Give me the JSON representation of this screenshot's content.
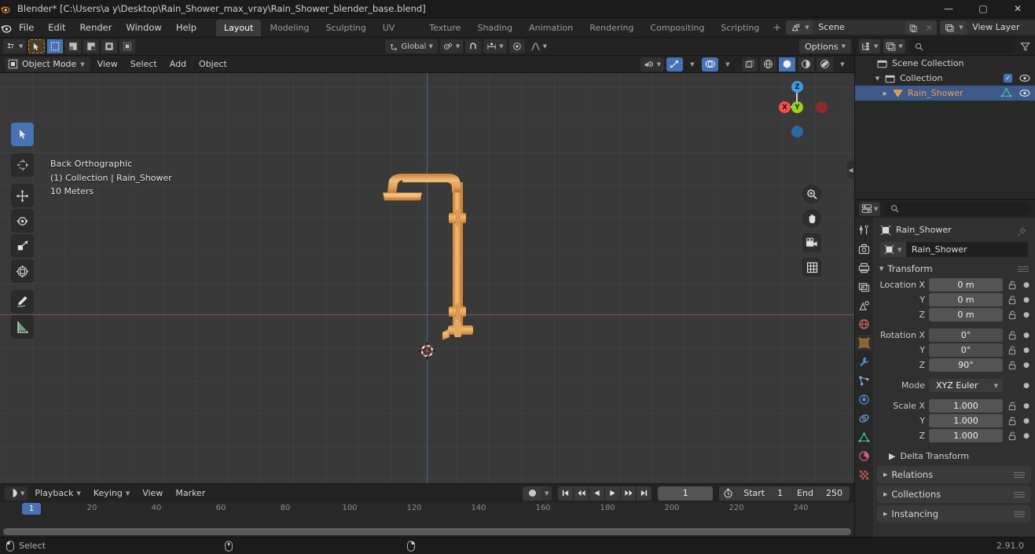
{
  "window": {
    "title": "Blender* [C:\\Users\\a y\\Desktop\\Rain_Shower_max_vray\\Rain_Shower_blender_base.blend]",
    "app_icon": "blender-logo-icon",
    "minimize": "—",
    "maximize": "▢",
    "close": "✕"
  },
  "topbar": {
    "menus": [
      "File",
      "Edit",
      "Render",
      "Window",
      "Help"
    ],
    "workspaces": [
      {
        "label": "Layout",
        "active": true
      },
      {
        "label": "Modeling",
        "active": false
      },
      {
        "label": "Sculpting",
        "active": false
      },
      {
        "label": "UV Editing",
        "active": false
      },
      {
        "label": "Texture Paint",
        "active": false
      },
      {
        "label": "Shading",
        "active": false
      },
      {
        "label": "Animation",
        "active": false
      },
      {
        "label": "Rendering",
        "active": false
      },
      {
        "label": "Compositing",
        "active": false
      },
      {
        "label": "Scripting",
        "active": false
      }
    ],
    "add_workspace": "+",
    "scene": {
      "name": "Scene",
      "new_label": "⧉",
      "unlink_label": "✕"
    },
    "view_layer": {
      "name": "View Layer",
      "new_label": "⧉",
      "unlink_label": "✕"
    }
  },
  "viewport": {
    "header_top": {
      "editor_type": "editor-type-icon",
      "transform_orientation": "Global",
      "snap_label": "snap",
      "proportional_label": "proportional-edit",
      "options": "Options"
    },
    "header_bottom": {
      "mode": "Object Mode",
      "menus": [
        "View",
        "Select",
        "Add",
        "Object"
      ]
    },
    "overlay_text": {
      "view_name": "Back Orthographic",
      "collection_object": "(1) Collection | Rain_Shower",
      "grid_scale": "10 Meters"
    },
    "tools": [
      {
        "name": "tweak-select-tool",
        "active": true
      },
      {
        "name": "cursor-tool",
        "active": false
      },
      {
        "name": "move-tool",
        "active": false
      },
      {
        "name": "rotate-tool",
        "active": false
      },
      {
        "name": "scale-tool",
        "active": false
      },
      {
        "name": "transform-tool",
        "active": false
      },
      {
        "name": "annotate-tool",
        "active": false
      },
      {
        "name": "measure-tool",
        "active": false
      }
    ],
    "gizmo": {
      "x": "X",
      "y": "Y",
      "z": "Z"
    },
    "nav_buttons": [
      "zoom-icon",
      "pan-hand-icon",
      "camera-view-icon",
      "toggle-ortho-icon"
    ]
  },
  "timeline": {
    "editor_icon": "timeline-editor-icon",
    "menus": [
      "Playback",
      "Keying",
      "View",
      "Marker"
    ],
    "auto_key": "record-icon",
    "transport": [
      "jump-start-icon",
      "prev-keyframe-icon",
      "play-reverse-icon",
      "play-icon",
      "next-keyframe-icon",
      "jump-end-icon"
    ],
    "current_frame": "1",
    "use_preview_range_icon": "stopwatch-icon",
    "start_label": "Start",
    "start_value": "1",
    "end_label": "End",
    "end_value": "250",
    "ruler_ticks": [
      "20",
      "40",
      "60",
      "80",
      "100",
      "120",
      "140",
      "160",
      "180",
      "200",
      "220",
      "240"
    ],
    "playhead_label": "1"
  },
  "outliner": {
    "display_mode_icon": "outliner-display-mode-icon",
    "filter_id_icon": "filter-id-icon",
    "search_placeholder": "",
    "search_value": "",
    "filter_icon": "funnel-filter-icon",
    "rows": [
      {
        "label": "Scene Collection",
        "icon": "scene-collection-icon",
        "indent": 0,
        "disclosure": "",
        "selected": false,
        "checkbox": false,
        "eye": false
      },
      {
        "label": "Collection",
        "icon": "collection-icon",
        "indent": 1,
        "disclosure": "▼",
        "selected": false,
        "checkbox": true,
        "eye": true
      },
      {
        "label": "Rain_Shower",
        "icon": "object-mesh-icon",
        "indent": 2,
        "disclosure": "▶",
        "selected": true,
        "checkbox": false,
        "eye": true,
        "data_icon": "mesh-data-icon"
      }
    ]
  },
  "properties": {
    "editor_icon": "properties-editor-icon",
    "search_placeholder": "",
    "search_value": "",
    "tabs": [
      {
        "name": "tool-tab",
        "icon": "tool-icon",
        "active": false
      },
      {
        "name": "render-tab",
        "icon": "render-camera-icon",
        "active": false
      },
      {
        "name": "output-tab",
        "icon": "printer-output-icon",
        "active": false
      },
      {
        "name": "view-layer-tab",
        "icon": "images-viewlayer-icon",
        "active": false
      },
      {
        "name": "scene-tab",
        "icon": "scene-cone-icon",
        "active": false
      },
      {
        "name": "world-tab",
        "icon": "world-globe-icon",
        "active": false
      },
      {
        "name": "object-tab",
        "icon": "object-square-icon",
        "active": true
      },
      {
        "name": "modifier-tab",
        "icon": "wrench-icon",
        "active": false
      },
      {
        "name": "particles-tab",
        "icon": "particles-icon",
        "active": false
      },
      {
        "name": "physics-tab",
        "icon": "physics-orbit-icon",
        "active": false
      },
      {
        "name": "constraints-tab",
        "icon": "constraint-icon",
        "active": false
      },
      {
        "name": "data-tab",
        "icon": "mesh-data-triangle-icon",
        "active": false
      },
      {
        "name": "material-tab",
        "icon": "material-sphere-icon",
        "active": false
      },
      {
        "name": "texture-tab",
        "icon": "texture-checker-icon",
        "active": false
      }
    ],
    "breadcrumb_object": "Rain_Shower",
    "pin_icon": "pin-icon",
    "object_name": "Rain_Shower",
    "transform_panel": "Transform",
    "fields": [
      {
        "label": "Location X",
        "value": "0 m"
      },
      {
        "label": "Y",
        "value": "0 m"
      },
      {
        "label": "Z",
        "value": "0 m"
      },
      {
        "label": "Rotation X",
        "value": "0°"
      },
      {
        "label": "Y",
        "value": "0°"
      },
      {
        "label": "Z",
        "value": "90°"
      }
    ],
    "mode_label": "Mode",
    "mode_value": "XYZ Euler",
    "scale_fields": [
      {
        "label": "Scale X",
        "value": "1.000"
      },
      {
        "label": "Y",
        "value": "1.000"
      },
      {
        "label": "Z",
        "value": "1.000"
      }
    ],
    "delta_transform": "Delta Transform",
    "panels": [
      "Relations",
      "Collections",
      "Instancing"
    ]
  },
  "statusbar": {
    "mouse_left_icon": "mouse-left-icon",
    "select_label": "Select",
    "mouse_middle_icon": "mouse-middle-icon",
    "mouse_right_icon": "mouse-right-icon",
    "version": "2.91.0"
  },
  "colors": {
    "accent_blue": "#4772b3",
    "object_orange": "#e8a760",
    "axis_x_red": "#8a4a4f",
    "axis_z_blue": "#4a6a96",
    "gizmo_x": "#fc4d4d",
    "gizmo_y": "#9ad11b",
    "gizmo_z": "#3e9be8"
  }
}
